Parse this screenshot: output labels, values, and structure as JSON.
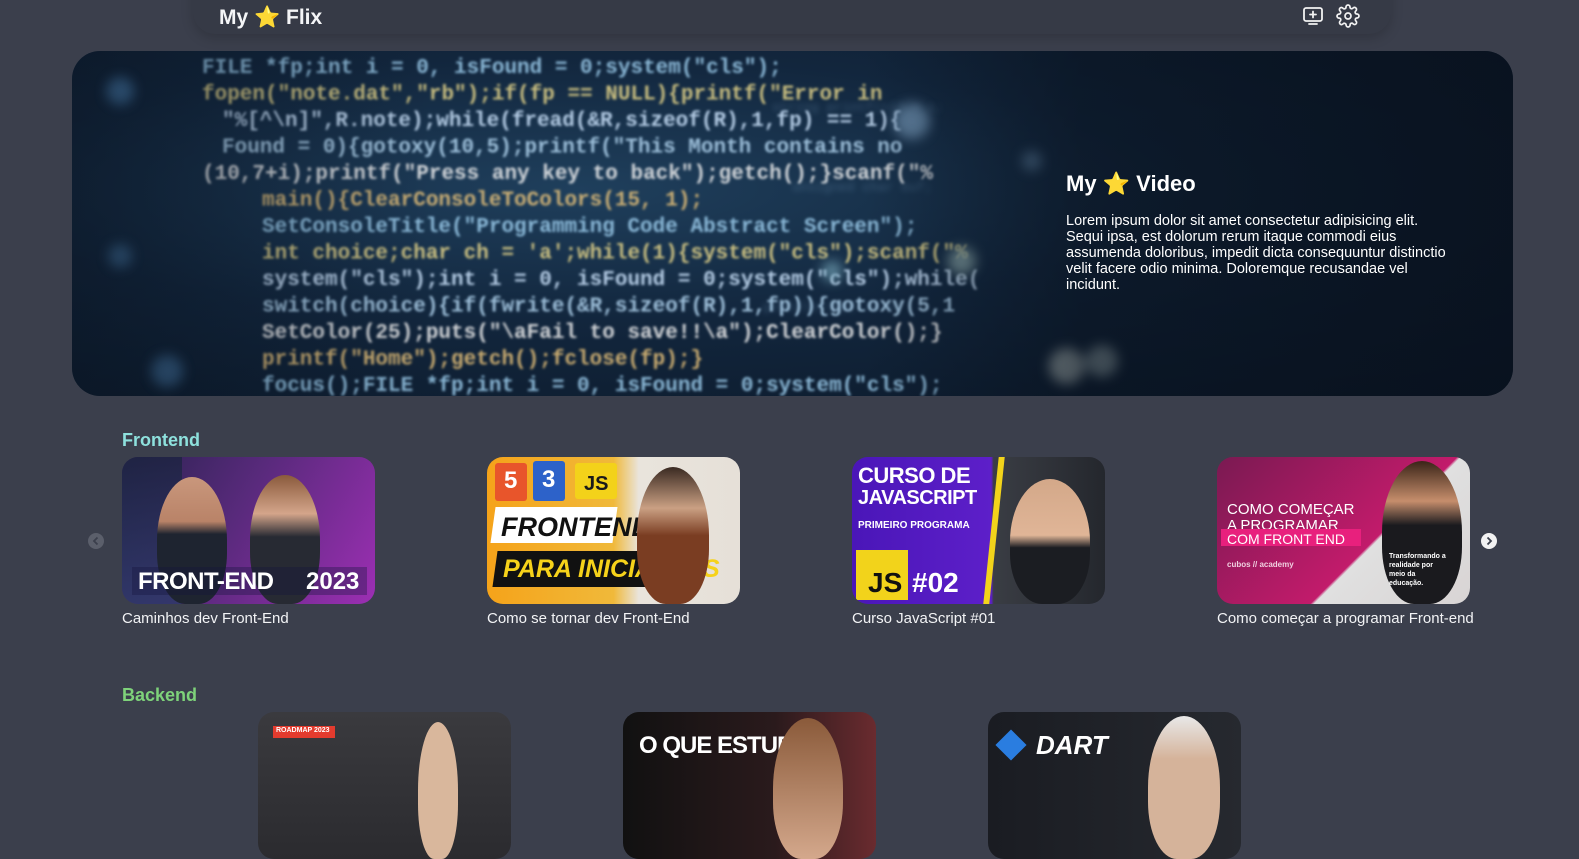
{
  "header": {
    "logo": "My ⭐ Flix",
    "icons": [
      "add-to-screen-icon",
      "gear-icon"
    ]
  },
  "hero": {
    "title": "My ⭐ Video",
    "description": "Lorem ipsum dolor sit amet consectetur adipisicing elit. Sequi ipsa, est dolorum rerum itaque commodi eius assumenda doloribus, impedit dicta consequuntur distinctio velit facere odio minima. Doloremque recusandae vel incidunt.",
    "code_lines": [
      "FILE *fp;int i = 0, isFound = 0;system(\"cls\");",
      "fopen(\"note.dat\",\"rb\");if(fp == NULL){printf(\"Error in",
      "\"%[^\\n]\",R.note);while(fread(&R,sizeof(R),1,fp) == 1){",
      "Found = 0){gotoxy(10,5);printf(\"This Month contains no",
      "(10,7+i);printf(\"Press any key to back\");getch();}scanf(\"%",
      "main(){ClearConsoleToColors(15, 1);",
      "SetConsoleTitle(\"Programming Code Abstract Screen\");",
      "int choice;char ch = 'a';while(1){system(\"cls\");scanf(\"%",
      "system(\"cls\");int i = 0, isFound = 0;system(\"cls\");while(",
      "switch(choice){if(fwrite(&R,sizeof(R),1,fp)){gotoxy(5,1",
      "SetColor(25);puts(\"\\aFail to save!!\\a\");ClearColor();}",
      "printf(\"Home\");getch();fclose(fp);}",
      "focus();FILE *fp;int i = 0, isFound = 0;system(\"cls\");"
    ]
  },
  "frontend": {
    "title": "Frontend",
    "videos": [
      {
        "title": "Caminhos dev Front-End",
        "thumb_text": [
          "FRONT-END",
          "2023"
        ]
      },
      {
        "title": "Como se tornar dev Front-End",
        "thumb_text": [
          "5",
          "3",
          "JS",
          "FRONTEND",
          "PARA INICIANTES"
        ]
      },
      {
        "title": "Curso JavaScript #01",
        "thumb_text": [
          "CURSO DE",
          "JAVASCRIPT",
          "PRIMEIRO PROGRAMA",
          "JS",
          "#02"
        ]
      },
      {
        "title": "Como começar a programar Front-end",
        "thumb_text": [
          "COMO COMEÇAR",
          "A PROGRAMAR",
          "COM FRONT END",
          "cubos // academy",
          "Transformando a realidade por meio da educação."
        ]
      }
    ]
  },
  "backend": {
    "title": "Backend",
    "videos": [
      {
        "thumb_text": [
          "ROADMAP 2023"
        ]
      },
      {
        "thumb_text": [
          "O QUE ESTUDAR"
        ]
      },
      {
        "thumb_text": [
          "DART"
        ]
      }
    ]
  },
  "colors": {
    "background": "#3b3f4c",
    "header": "#363a46",
    "frontend_title": "#8ee1dd",
    "backend_title": "#7ed27a"
  }
}
